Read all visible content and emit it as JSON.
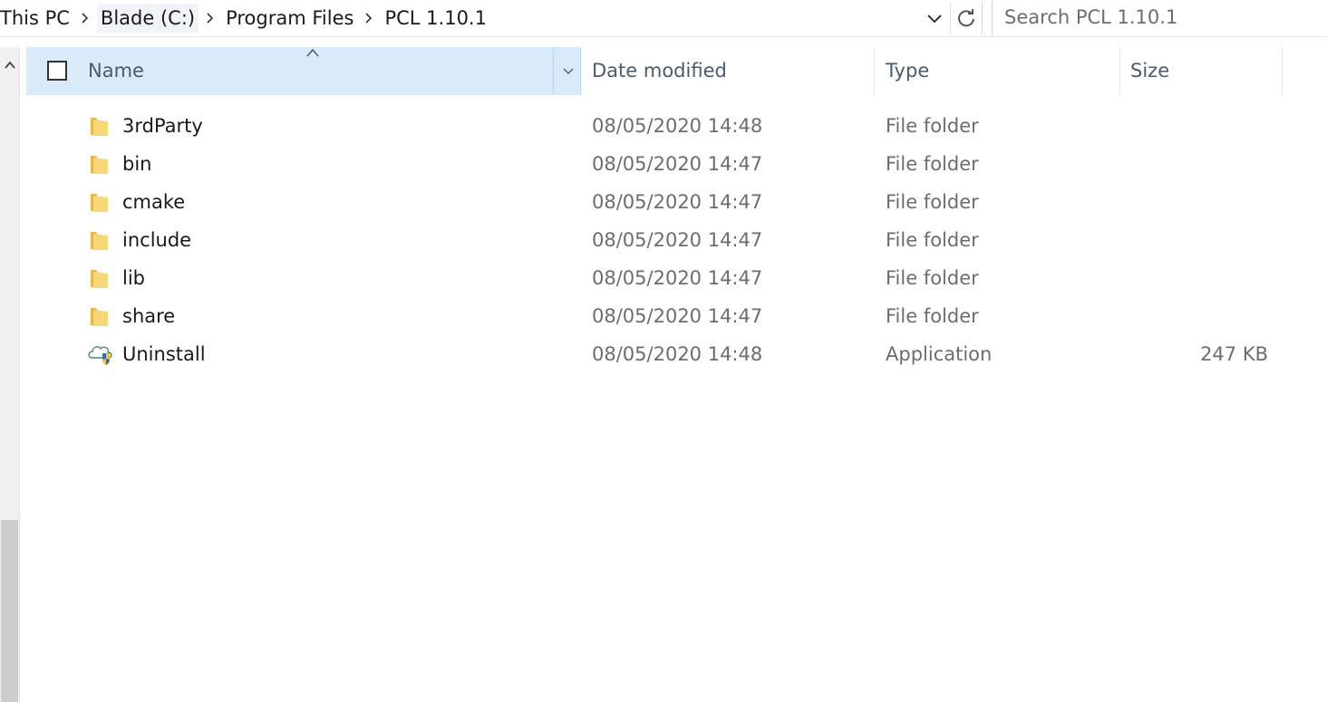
{
  "breadcrumb": {
    "items": [
      {
        "label": "This PC"
      },
      {
        "label": "Blade (C:)"
      },
      {
        "label": "Program Files"
      },
      {
        "label": "PCL 1.10.1"
      }
    ]
  },
  "search": {
    "placeholder": "Search PCL 1.10.1"
  },
  "columns": {
    "name": "Name",
    "date_modified": "Date modified",
    "type": "Type",
    "size": "Size"
  },
  "files": [
    {
      "name": "3rdParty",
      "date": "08/05/2020 14:48",
      "type": "File folder",
      "size": "",
      "icon": "folder-icon"
    },
    {
      "name": "bin",
      "date": "08/05/2020 14:47",
      "type": "File folder",
      "size": "",
      "icon": "folder-icon"
    },
    {
      "name": "cmake",
      "date": "08/05/2020 14:47",
      "type": "File folder",
      "size": "",
      "icon": "folder-icon"
    },
    {
      "name": "include",
      "date": "08/05/2020 14:47",
      "type": "File folder",
      "size": "",
      "icon": "folder-icon"
    },
    {
      "name": "lib",
      "date": "08/05/2020 14:47",
      "type": "File folder",
      "size": "",
      "icon": "folder-icon"
    },
    {
      "name": "share",
      "date": "08/05/2020 14:47",
      "type": "File folder",
      "size": "",
      "icon": "folder-icon"
    },
    {
      "name": "Uninstall",
      "date": "08/05/2020 14:48",
      "type": "Application",
      "size": "247 KB",
      "icon": "uninstaller-app-icon"
    }
  ],
  "colors": {
    "header_selected": "#d9ebf9",
    "folder_yellow": "#f8d775",
    "secondary_text": "#6d6d6d"
  }
}
